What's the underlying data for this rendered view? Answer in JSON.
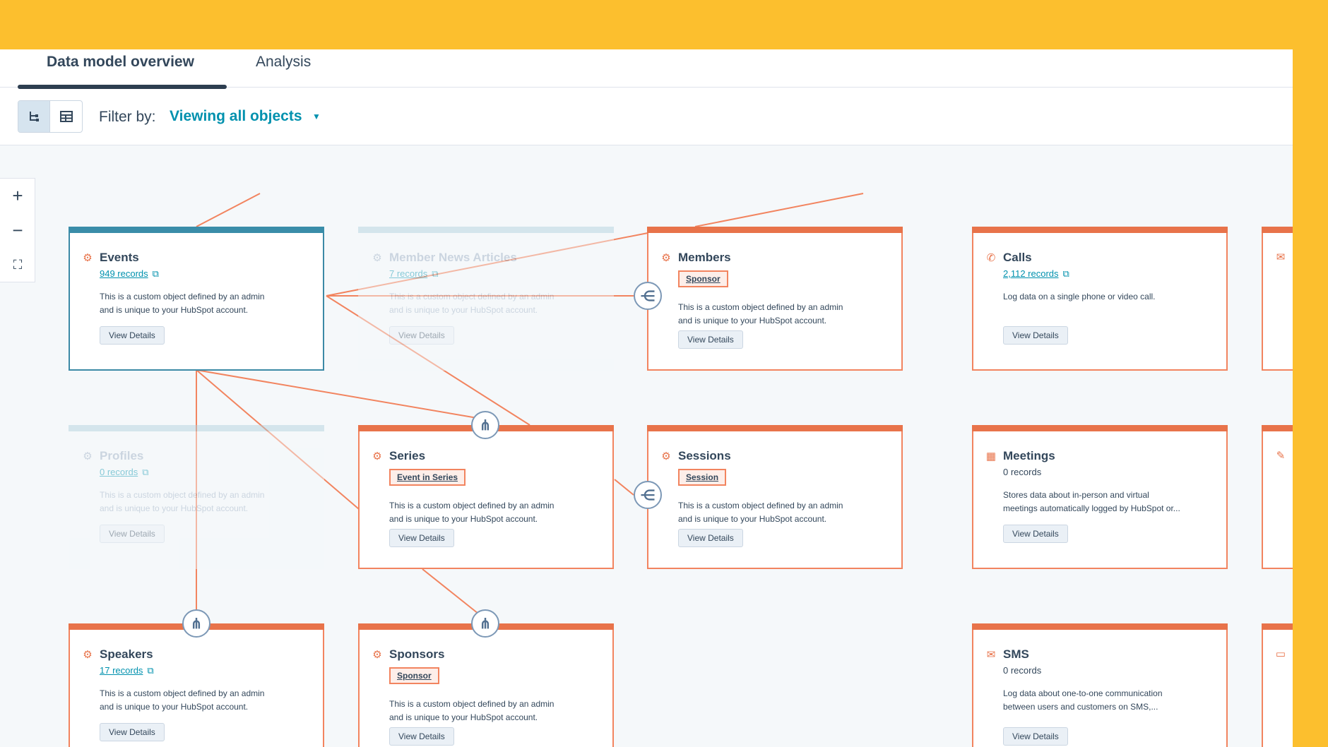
{
  "tabs": [
    {
      "label": "Data model overview",
      "active": true
    },
    {
      "label": "Analysis",
      "active": false
    }
  ],
  "toolbar": {
    "filter_label": "Filter by:",
    "filter_value": "Viewing all objects",
    "view_modes": [
      "tree-view",
      "table-view"
    ]
  },
  "zoom": {
    "in": "+",
    "out": "−",
    "fit": "⛶"
  },
  "colors": {
    "accent_orange": "#e8734a",
    "selected_teal": "#3a8da9",
    "link": "#0091ae",
    "brand_yellow": "#fcbf2e"
  },
  "common": {
    "view_details": "View Details"
  },
  "cards": {
    "events": {
      "title": "Events",
      "records": "949 records",
      "desc1": "This is a custom object defined by an admin",
      "desc2": "and is unique to your HubSpot account.",
      "icon": "custom-object-icon"
    },
    "member_news": {
      "title": "Member News Articles",
      "records": "7 records",
      "desc1": "This is a custom object defined by an admin",
      "desc2": "and is unique to your HubSpot account.",
      "icon": "custom-object-icon"
    },
    "members": {
      "title": "Members",
      "badge": "Sponsor",
      "desc1": "This is a custom object defined by an admin",
      "desc2": "and is unique to your HubSpot account.",
      "icon": "custom-object-icon"
    },
    "calls": {
      "title": "Calls",
      "records": "2,112 records",
      "desc1": "Log data on a single phone or video call.",
      "icon": "phone-icon"
    },
    "profiles": {
      "title": "Profiles",
      "records": "0 records",
      "desc1": "This is a custom object defined by an admin",
      "desc2": "and is unique to your HubSpot account.",
      "icon": "custom-object-icon"
    },
    "series": {
      "title": "Series",
      "badge": "Event in Series",
      "desc1": "This is a custom object defined by an admin",
      "desc2": "and is unique to your HubSpot account.",
      "icon": "custom-object-icon"
    },
    "sessions": {
      "title": "Sessions",
      "badge": "Session",
      "desc1": "This is a custom object defined by an admin",
      "desc2": "and is unique to your HubSpot account.",
      "icon": "custom-object-icon"
    },
    "meetings": {
      "title": "Meetings",
      "records": "0 records",
      "desc1": "Stores data about in-person and virtual",
      "desc2": "meetings automatically logged by HubSpot or...",
      "icon": "calendar-icon"
    },
    "speakers": {
      "title": "Speakers",
      "records": "17 records",
      "desc1": "This is a custom object defined by an admin",
      "desc2": "and is unique to your HubSpot account.",
      "icon": "custom-object-icon"
    },
    "sponsors": {
      "title": "Sponsors",
      "badge": "Sponsor",
      "desc1": "This is a custom object defined by an admin",
      "desc2": "and is unique to your HubSpot account.",
      "icon": "custom-object-icon"
    },
    "sms": {
      "title": "SMS",
      "records": "0 records",
      "desc1": "Log data about one-to-one communication",
      "desc2": "between users and customers on SMS,...",
      "icon": "chat-icon"
    }
  }
}
